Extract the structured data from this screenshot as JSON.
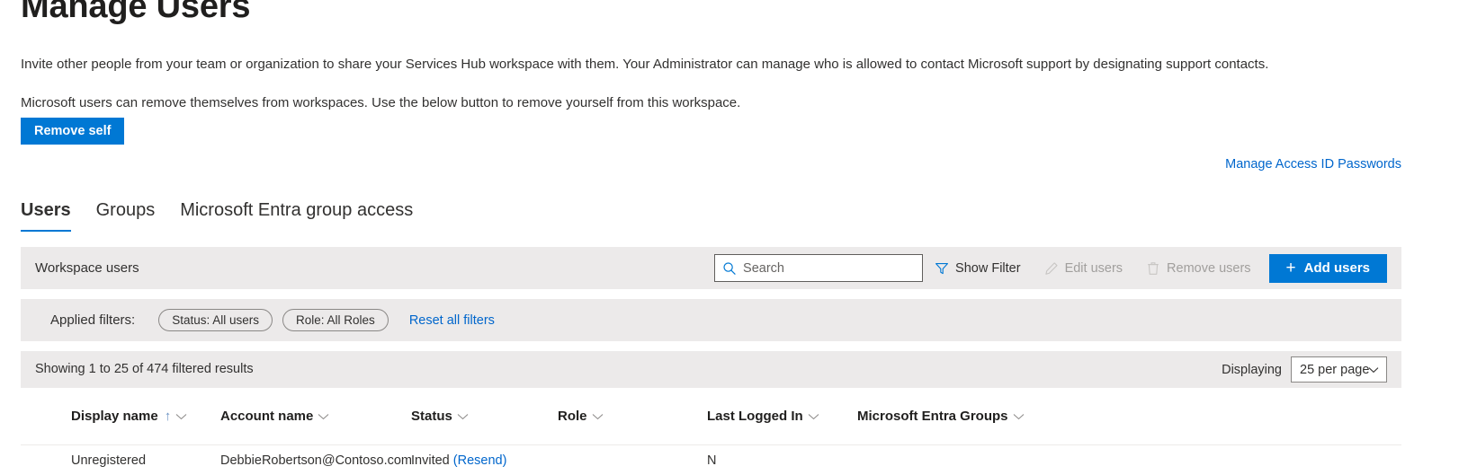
{
  "page": {
    "title": "Manage Users",
    "intro_paragraph_1": "Invite other people from your team or organization to share your Services Hub workspace with them. Your Administrator can manage who is allowed to contact Microsoft support by designating support contacts.",
    "intro_paragraph_2": "Microsoft users can remove themselves from workspaces. Use the below button to remove yourself from this workspace.",
    "remove_self_label": "Remove self",
    "manage_access_link": "Manage Access ID Passwords"
  },
  "tabs": [
    {
      "label": "Users",
      "active": true
    },
    {
      "label": "Groups",
      "active": false
    },
    {
      "label": "Microsoft Entra group access",
      "active": false
    }
  ],
  "toolbar": {
    "section_title": "Workspace users",
    "search": {
      "placeholder": "Search",
      "value": "",
      "icon": "search-icon"
    },
    "show_filter_label": "Show Filter",
    "show_filter_icon": "filter-icon",
    "edit_users_label": "Edit users",
    "edit_users_icon": "pencil-icon",
    "edit_users_disabled": true,
    "remove_users_label": "Remove users",
    "remove_users_icon": "trash-icon",
    "remove_users_disabled": true,
    "add_users_label": "Add users",
    "add_users_icon": "plus-icon"
  },
  "filters": {
    "label": "Applied filters:",
    "chips": [
      {
        "label": "Status: All users"
      },
      {
        "label": "Role: All Roles"
      }
    ],
    "reset_label": "Reset all filters"
  },
  "results": {
    "showing_text": "Showing 1 to 25 of 474 filtered results",
    "displaying_label": "Displaying",
    "per_page_value": "25 per page"
  },
  "table": {
    "columns": [
      {
        "label": "Display name",
        "sorted": "asc"
      },
      {
        "label": "Account name",
        "sorted": ""
      },
      {
        "label": "Status",
        "sorted": ""
      },
      {
        "label": "Role",
        "sorted": ""
      },
      {
        "label": "Last Logged In",
        "sorted": ""
      },
      {
        "label": "Microsoft Entra Groups",
        "sorted": ""
      }
    ],
    "rows": [
      {
        "display_name": "Unregistered",
        "account_name": "DebbieRobertson@Contoso.com",
        "status": "Invited",
        "status_action": "(Resend)",
        "role": "",
        "last_logged_in": "N",
        "entra_groups": ""
      }
    ]
  },
  "colors": {
    "accent": "#0078d4",
    "link": "#0066cc",
    "band": "#eceaea",
    "text": "#323130",
    "disabled": "#a19f9d"
  }
}
